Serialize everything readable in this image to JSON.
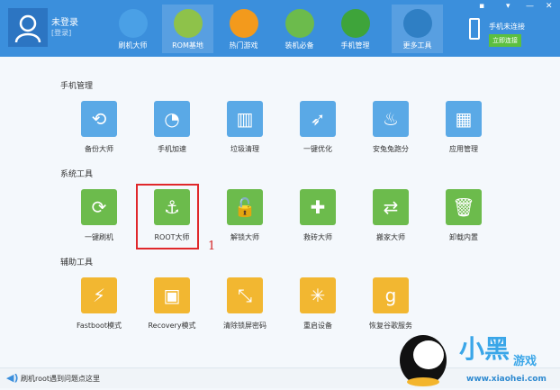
{
  "user": {
    "name": "未登录",
    "login": "[登录]"
  },
  "nav": [
    {
      "label": "刷机大师",
      "color": "#4aa0e6"
    },
    {
      "label": "ROM基地",
      "color": "#8ec24a"
    },
    {
      "label": "热门游戏",
      "color": "#f39a1c"
    },
    {
      "label": "装机必备",
      "color": "#6cbb4c"
    },
    {
      "label": "手机管理",
      "color": "#3ea43a"
    },
    {
      "label": "更多工具",
      "color": "#2f7fc4"
    }
  ],
  "phone": {
    "status": "手机未连接",
    "connect": "立即连接"
  },
  "sections": [
    {
      "title": "手机管理",
      "items": [
        {
          "label": "备份大师",
          "icon": "⟲"
        },
        {
          "label": "手机加速",
          "icon": "◔"
        },
        {
          "label": "垃圾清理",
          "icon": "▥"
        },
        {
          "label": "一键优化",
          "icon": "➶"
        },
        {
          "label": "安兔兔跑分",
          "icon": "♨"
        },
        {
          "label": "应用管理",
          "icon": "▦"
        }
      ]
    },
    {
      "title": "系统工具",
      "items": [
        {
          "label": "一键刷机",
          "icon": "⟳"
        },
        {
          "label": "ROOT大师",
          "icon": "⚓"
        },
        {
          "label": "解锁大师",
          "icon": "🔓"
        },
        {
          "label": "救砖大师",
          "icon": "✚"
        },
        {
          "label": "搬家大师",
          "icon": "⇄"
        },
        {
          "label": "卸载内置",
          "icon": "🗑"
        }
      ]
    },
    {
      "title": "辅助工具",
      "items": [
        {
          "label": "Fastboot模式",
          "icon": "⚡"
        },
        {
          "label": "Recovery模式",
          "icon": "▣"
        },
        {
          "label": "清除锁屏密码",
          "icon": "⤡"
        },
        {
          "label": "重启设备",
          "icon": "✳"
        },
        {
          "label": "恢复谷歌服务",
          "icon": "g"
        }
      ]
    }
  ],
  "annotation": "1",
  "status": "刷机root遇到问题点这里",
  "watermark": {
    "text": "小黑游戏",
    "url": "www.xiaohei.com"
  }
}
